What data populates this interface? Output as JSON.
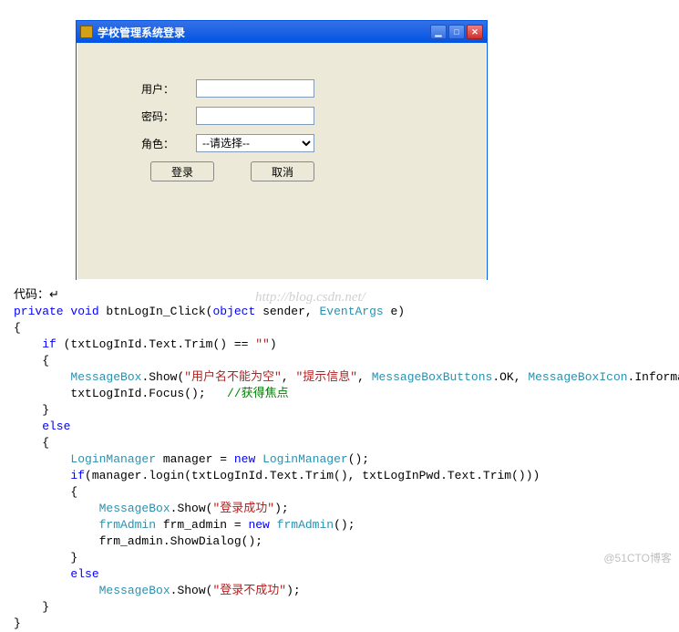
{
  "window": {
    "title": "学校管理系统登录",
    "minimize": "▁",
    "maximize": "□",
    "close": "✕"
  },
  "form": {
    "user_label": "用户：",
    "pwd_label": "密码：",
    "role_label": "角色：",
    "role_placeholder": "--请选择--",
    "login_btn": "登录",
    "cancel_btn": "取消"
  },
  "code_label": "代码：↵",
  "watermark": "http://blog.csdn.net/",
  "footer": "@51CTO博客",
  "code": {
    "l1_a": "private",
    "l1_b": " void",
    "l1_c": " btnLogIn_Click(",
    "l1_d": "object",
    "l1_e": " sender, ",
    "l1_f": "EventArgs",
    "l1_g": " e)",
    "l2": "{",
    "l3_a": "    if",
    "l3_b": " (txtLogInId.Text.Trim() == ",
    "l3_c": "\"\"",
    "l3_d": ")",
    "l4": "    {",
    "l5_a": "        MessageBox",
    "l5_b": ".Show(",
    "l5_c": "\"用户名不能为空\"",
    "l5_d": ", ",
    "l5_e": "\"提示信息\"",
    "l5_f": ", ",
    "l5_g": "MessageBoxButtons",
    "l5_h": ".OK, ",
    "l5_i": "MessageBoxIcon",
    "l5_j": ".Information);",
    "l6_a": "        txtLogInId.Focus();   ",
    "l6_b": "//获得焦点",
    "l7": "    }",
    "l8_a": "    else",
    "l9": "    {",
    "l10_a": "        LoginManager",
    "l10_b": " manager = ",
    "l10_c": "new",
    "l10_d": " ",
    "l10_e": "LoginManager",
    "l10_f": "();",
    "l11_a": "        if",
    "l11_b": "(manager.login(txtLogInId.Text.Trim(), txtLogInPwd.Text.Trim()))",
    "l12": "        {",
    "l13_a": "            MessageBox",
    "l13_b": ".Show(",
    "l13_c": "\"登录成功\"",
    "l13_d": ");",
    "l14_a": "            frmAdmin",
    "l14_b": " frm_admin = ",
    "l14_c": "new",
    "l14_d": " ",
    "l14_e": "frmAdmin",
    "l14_f": "();",
    "l15": "            frm_admin.ShowDialog();",
    "l16": "        }",
    "l17_a": "        else",
    "l18_a": "            MessageBox",
    "l18_b": ".Show(",
    "l18_c": "\"登录不成功\"",
    "l18_d": ");",
    "l19": "    }",
    "l20": "}"
  }
}
